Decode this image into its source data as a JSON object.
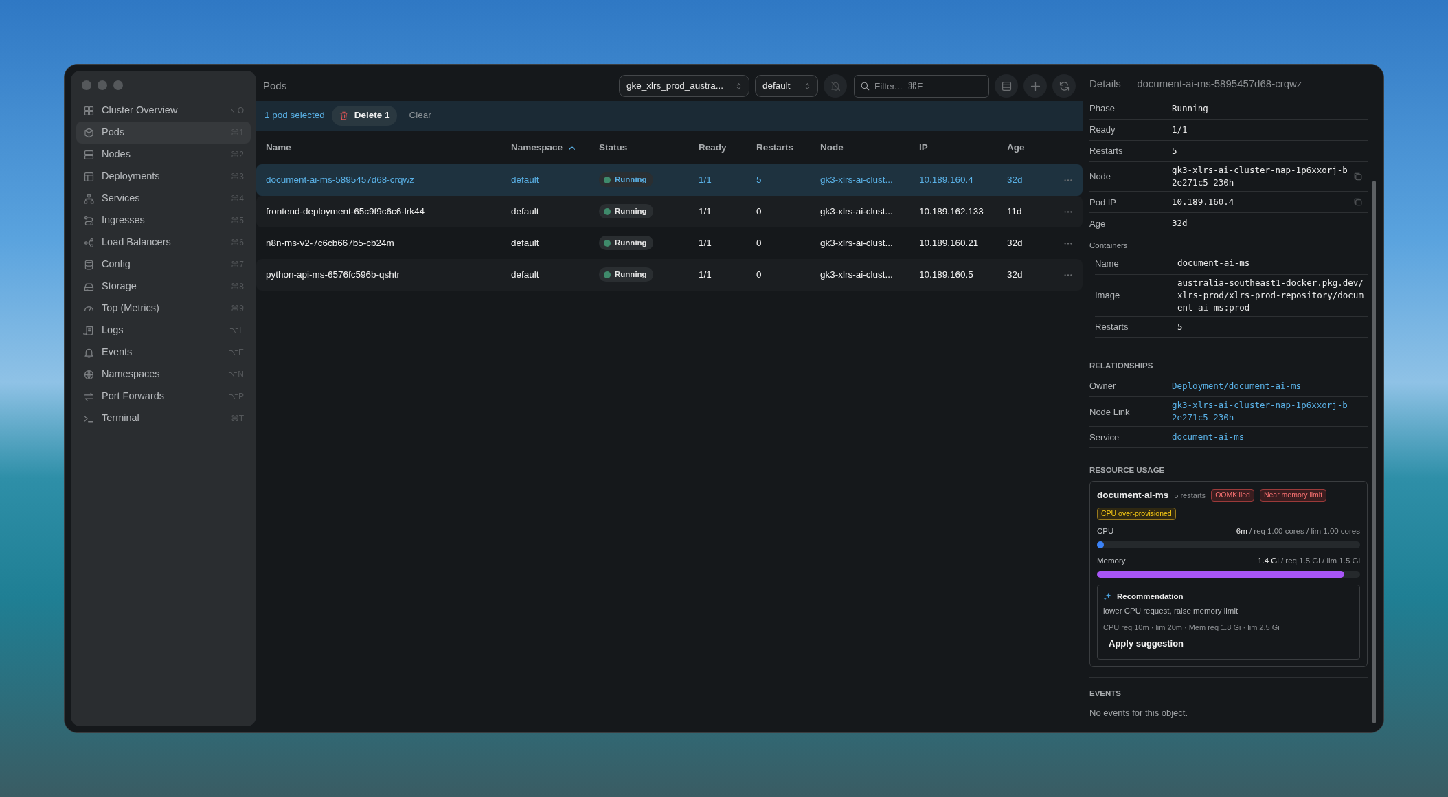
{
  "sidebar": {
    "items": [
      {
        "label": "Cluster Overview",
        "shortcut": "⌥O",
        "selected": false
      },
      {
        "label": "Pods",
        "shortcut": "⌘1",
        "selected": true
      },
      {
        "label": "Nodes",
        "shortcut": "⌘2",
        "selected": false
      },
      {
        "label": "Deployments",
        "shortcut": "⌘3",
        "selected": false
      },
      {
        "label": "Services",
        "shortcut": "⌘4",
        "selected": false
      },
      {
        "label": "Ingresses",
        "shortcut": "⌘5",
        "selected": false
      },
      {
        "label": "Load Balancers",
        "shortcut": "⌘6",
        "selected": false
      },
      {
        "label": "Config",
        "shortcut": "⌘7",
        "selected": false
      },
      {
        "label": "Storage",
        "shortcut": "⌘8",
        "selected": false
      },
      {
        "label": "Top (Metrics)",
        "shortcut": "⌘9",
        "selected": false
      },
      {
        "label": "Logs",
        "shortcut": "⌥L",
        "selected": false
      },
      {
        "label": "Events",
        "shortcut": "⌥E",
        "selected": false
      },
      {
        "label": "Namespaces",
        "shortcut": "⌥N",
        "selected": false
      },
      {
        "label": "Port Forwards",
        "shortcut": "⌥P",
        "selected": false
      },
      {
        "label": "Terminal",
        "shortcut": "⌘T",
        "selected": false
      }
    ]
  },
  "toolbar": {
    "title": "Pods",
    "context": "gke_xlrs_prod_austra...",
    "namespace": "default",
    "search": {
      "placeholder": "Filter...  ⌘F"
    }
  },
  "selection_bar": {
    "count": "1 pod selected",
    "delete": "Delete 1",
    "clear": "Clear"
  },
  "table": {
    "columns": [
      {
        "label": "Name",
        "sorted": false
      },
      {
        "label": "Namespace",
        "sorted": true
      },
      {
        "label": "Status",
        "sorted": false
      },
      {
        "label": "Ready",
        "sorted": false
      },
      {
        "label": "Restarts",
        "sorted": false
      },
      {
        "label": "Node",
        "sorted": false
      },
      {
        "label": "IP",
        "sorted": false
      },
      {
        "label": "Age",
        "sorted": false
      }
    ],
    "rows": [
      {
        "selected": true,
        "cells": [
          "document-ai-ms-5895457d68-crqwz",
          "default",
          "Running",
          "1/1",
          "5",
          "gk3-xlrs-ai-clust...",
          "10.189.160.4",
          "32d"
        ]
      },
      {
        "selected": false,
        "cells": [
          "frontend-deployment-65c9f9c6c6-lrk44",
          "default",
          "Running",
          "1/1",
          "0",
          "gk3-xlrs-ai-clust...",
          "10.189.162.133",
          "11d"
        ]
      },
      {
        "selected": false,
        "cells": [
          "n8n-ms-v2-7c6cb667b5-cb24m",
          "default",
          "Running",
          "1/1",
          "0",
          "gk3-xlrs-ai-clust...",
          "10.189.160.21",
          "32d"
        ]
      },
      {
        "selected": false,
        "cells": [
          "python-api-ms-6576fc596b-qshtr",
          "default",
          "Running",
          "1/1",
          "0",
          "gk3-xlrs-ai-clust...",
          "10.189.160.5",
          "32d"
        ]
      }
    ]
  },
  "details": {
    "title": "Details — document-ai-ms-5895457d68-crqwz",
    "fields": [
      {
        "label": "Phase",
        "value": "Running",
        "copyable": false
      },
      {
        "label": "Ready",
        "value": "1/1",
        "copyable": false
      },
      {
        "label": "Restarts",
        "value": "5",
        "copyable": false
      },
      {
        "label": "Node",
        "value": "gk3-xlrs-ai-cluster-nap-1p6xxorj-b2e271c5-230h",
        "copyable": true
      },
      {
        "label": "Pod IP",
        "value": "10.189.160.4",
        "copyable": true
      },
      {
        "label": "Age",
        "value": "32d",
        "copyable": false
      }
    ],
    "containers": {
      "heading": "Containers",
      "fields": [
        {
          "label": "Name",
          "value": "document-ai-ms"
        },
        {
          "label": "Image",
          "value": "australia-southeast1-docker.pkg.dev/xlrs-prod/xlrs-prod-repository/document-ai-ms:prod"
        },
        {
          "label": "Restarts",
          "value": "5"
        }
      ]
    },
    "relationships": {
      "heading": "RELATIONSHIPS",
      "fields": [
        {
          "label": "Owner",
          "value": "Deployment/document-ai-ms"
        },
        {
          "label": "Node Link",
          "value": "gk3-xlrs-ai-cluster-nap-1p6xxorj-b2e271c5-230h"
        },
        {
          "label": "Service",
          "value": "document-ai-ms"
        }
      ]
    },
    "resource_usage": {
      "heading": "RESOURCE USAGE",
      "container": "document-ai-ms",
      "restarts": "5 restarts",
      "tags": [
        {
          "label": "OOMKilled",
          "kind": "danger"
        },
        {
          "label": "Near memory limit",
          "kind": "danger"
        },
        {
          "label": "CPU over-provisioned",
          "kind": "warning"
        }
      ],
      "meters": [
        {
          "name": "CPU",
          "reading": "**6m** / req 1.00 cores / lim 1.00 cores",
          "level": 0.006,
          "color": "#3b82f6"
        },
        {
          "name": "Memory",
          "reading": "**1.4 Gi** / req 1.5 Gi / lim 1.5 Gi",
          "level": 0.94,
          "color": "#a855f7"
        }
      ],
      "recommendation": {
        "title": "Recommendation",
        "text": "lower CPU request, raise memory limit",
        "detail": "CPU req 10m · lim 20m · Mem req 1.8 Gi · lim 2.5 Gi",
        "button": "Apply suggestion"
      }
    },
    "events": {
      "heading": "EVENTS",
      "empty": "No events for this object."
    }
  }
}
